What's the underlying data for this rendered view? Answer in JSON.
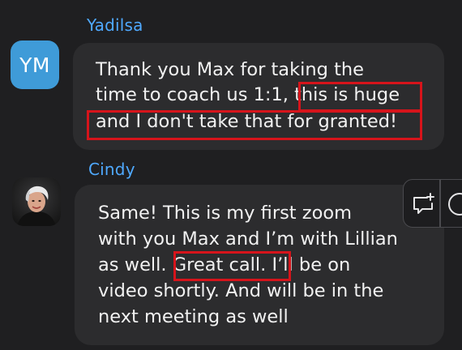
{
  "messages": [
    {
      "sender": "Yadilsa",
      "avatar_initials": "YM",
      "avatar_color": "#3f9bd8",
      "lines": [
        "Thank you Max for taking the",
        "time to coach us 1:1, this is huge",
        "and I don't take that for granted!"
      ],
      "highlight_text": "this is huge and I don't take that for granted!"
    },
    {
      "sender": "Cindy",
      "avatar_type": "photo",
      "lines": [
        "Same!  This is my first zoom",
        "with you Max and I’m with Lillian",
        "as well.  Great call.  I’ll be on",
        "video shortly.  And will be in the",
        "next meeting as well"
      ],
      "highlight_text": "Great call."
    }
  ],
  "hover_toolbar": {
    "actions": [
      {
        "name": "add-comment",
        "icon": "comment-plus-icon"
      },
      {
        "name": "more",
        "icon": "more-icon"
      }
    ]
  },
  "colors": {
    "background": "#1f1f21",
    "bubble": "#2c2c2e",
    "sender_name": "#4fa9ff",
    "highlight_border": "#d6141b",
    "text": "#f1f1f1"
  }
}
